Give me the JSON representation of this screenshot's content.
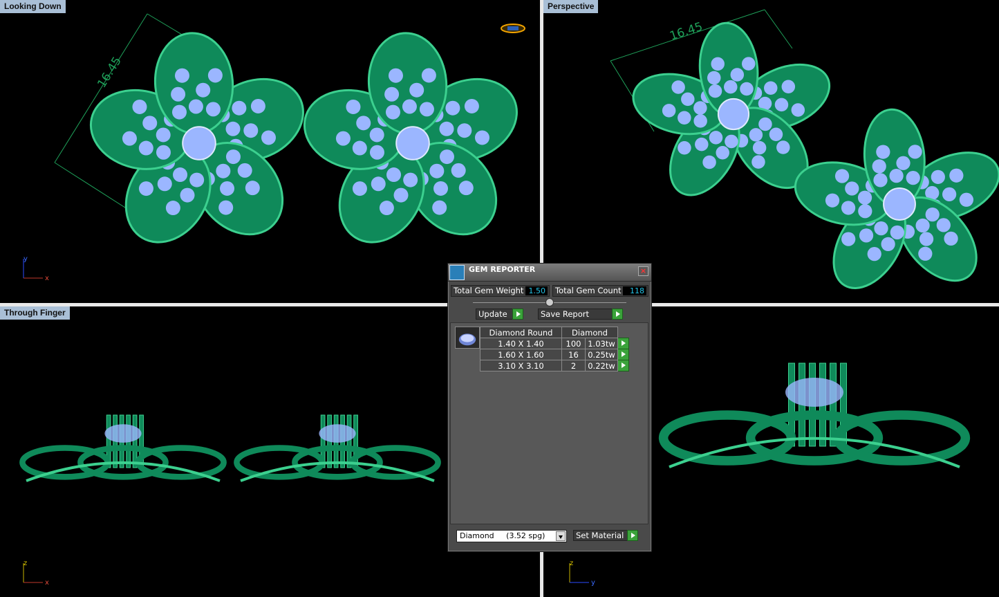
{
  "viewports": {
    "top_left": {
      "label": "Looking Down",
      "dimension": "16.45",
      "axis_v": "y",
      "axis_h": "x"
    },
    "top_right": {
      "label": "Perspective",
      "dimension": "16.45"
    },
    "bottom_left": {
      "label": "Through Finger",
      "axis_v": "z",
      "axis_h": "x"
    },
    "bottom_right": {
      "axis_v": "z",
      "axis_h": "y"
    }
  },
  "colors": {
    "metal": "#0f8a5a",
    "metal_light": "#3cd08f",
    "gem": "#9bb6ff",
    "dimension": "#1fa15a",
    "label_bg": "#a9bfd6"
  },
  "gem_reporter": {
    "title": "GEM REPORTER",
    "close_icon": "close-icon",
    "total_weight_label": "Total Gem Weight",
    "total_weight_value": "1.50",
    "total_count_label": "Total Gem Count",
    "total_count_value": "118",
    "update_label": "Update",
    "save_report_label": "Save Report",
    "table": {
      "header_shape": "Diamond Round",
      "header_material": "Diamond",
      "rows": [
        {
          "size": "1.40 X 1.40",
          "count": "100",
          "weight": "1.03tw"
        },
        {
          "size": "1.60 X 1.60",
          "count": "16",
          "weight": "0.25tw"
        },
        {
          "size": "3.10 X 3.10",
          "count": "2",
          "weight": "0.22tw"
        }
      ]
    },
    "material_select": "Diamond     (3.52 spg)",
    "set_material_label": "Set Material"
  }
}
